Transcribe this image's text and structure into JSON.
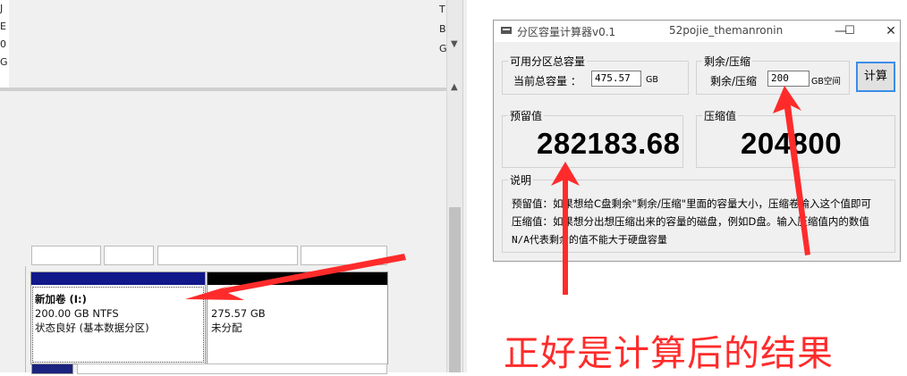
{
  "disk_manager": {
    "left_edge_chars": [
      "J",
      "E",
      "0",
      "G"
    ],
    "right_edge_chars": [
      "T",
      "B",
      "G",
      "G"
    ],
    "volume": {
      "name": "新加卷  (I:)",
      "size": "200.00 GB NTFS",
      "status": "状态良好 (基本数据分区)"
    },
    "unallocated": {
      "size": "275.57 GB",
      "status": "未分配"
    }
  },
  "calculator": {
    "title": "分区容量计算器v0.1",
    "author": "52pojie_themanronin",
    "window_buttons": {
      "minimize": "—",
      "maximize": "☐",
      "close": "✕"
    },
    "total_group": {
      "label": "可用分区总容量",
      "current_label": "当前总容量 ：",
      "current_value": "475.57",
      "unit": "GB"
    },
    "shrink_group": {
      "label": "剩余/压缩",
      "field_label": "剩余/压缩",
      "field_value": "200",
      "unit": "GB空间"
    },
    "calc_button": "计算",
    "reserve_group": {
      "label": "预留值",
      "value": "282183.68"
    },
    "compress_group": {
      "label": "压缩值",
      "value": "204800"
    },
    "explain_group": {
      "label": "说明",
      "lines": [
        "预留值：如果想给C盘剩余\"剩余/压缩\"里面的容量大小，压缩卷输入这个值即可",
        "压缩值：如果想分出想压缩出来的容量的磁盘，例如D盘。输入压缩值内的数值",
        "N/A代表剩余的值不能大于硬盘容量"
      ]
    }
  },
  "annotation": {
    "caption": "正好是计算后的结果",
    "color": "#ff2b2b"
  }
}
